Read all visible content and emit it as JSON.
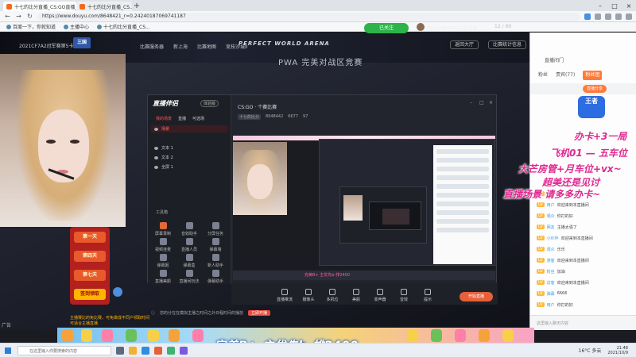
{
  "browser": {
    "tabs": [
      {
        "label": "十七的比分直播_CS:GO直播_斗..."
      },
      {
        "label": "十七的比分直播_CS..."
      }
    ],
    "url": "https://www.douyu.com/8648421_r=0.24240187069741187",
    "bookmarks": [
      "百度一下，你就知道",
      "主播中心",
      "十七的比分直播_CS..."
    ]
  },
  "stream": {
    "arena_title": "PERFECT WORLD ARENA",
    "arena_sub": "2021CF7A2冠军赛第5卡",
    "arena_logo": "三国",
    "follow_label": "已关注",
    "host_name": "douyu8648442比分直…",
    "viewer_count": "12 / 69",
    "game_links": [
      "比赛服务器",
      "新上海",
      "比赛地图",
      "竞技沙城II"
    ],
    "game_btn1": "返回大厅",
    "game_btn2": "比赛统计信息",
    "pwa_text": "PWA 完美对战区竞赛"
  },
  "promo": {
    "lines": [
      "第一天",
      "第四天",
      "第七天",
      "签到领取"
    ],
    "note": "主播赛比的免比赛，可免做成不同户领取时间可适合主播直播",
    "side_tab": "广告"
  },
  "obs": {
    "brand": "直播伴侣",
    "badge": "体验版",
    "tabs": [
      "我的场景",
      "直播",
      "可选场"
    ],
    "scenes": [
      "场景",
      "文本 1",
      "文本 2",
      "全屏 1"
    ],
    "tools_label": "工具箱",
    "tools": [
      "屏幕录制",
      "音效助手",
      "分屏任务",
      "视频连麦",
      "直播人员",
      "弹幕墙",
      "弹幕姬",
      "弹幕盒",
      "新人助手",
      "直播美颜",
      "直播间玩法",
      "弹幕助手"
    ],
    "game_name": "CS:GO · 个赛比赛",
    "stats": [
      "十七的比分",
      "8648442",
      "6677",
      "97"
    ],
    "inner_strip_text": "完美B+ 主优先b-排2400",
    "bottom_buttons": [
      "直播推流",
      "摄像头",
      "多机位",
      "美颜",
      "变声器",
      "音效",
      "提示"
    ],
    "start_label": "开始直播",
    "tip_text": "您的分在在模拟主播之时间之外日程时间的播放",
    "tip_action": "立即开播"
  },
  "chat": {
    "top_text": "直播间门",
    "tabs": [
      "粉丝",
      "贵宾(77)",
      "粉丝团"
    ],
    "strip_btn": "直播分享",
    "logo": "王者",
    "messages": [
      {
        "name": "欢迎",
        "text": "加入主播"
      },
      {
        "name": "用户",
        "text": "欢迎来到本直播间"
      },
      {
        "name": "观众",
        "text": "你打的好"
      },
      {
        "name": "网友",
        "text": "主播太强了"
      },
      {
        "name": "小伙伴",
        "text": "欢迎来到本直播间"
      },
      {
        "name": "观众",
        "text": "乐乐"
      },
      {
        "name": "游客",
        "text": "欢迎来到本直播间"
      },
      {
        "name": "粉丝",
        "text": "加油"
      },
      {
        "name": "访客",
        "text": "欢迎来到本直播间"
      },
      {
        "name": "弹幕",
        "text": "6666"
      },
      {
        "name": "用户",
        "text": "你打的好"
      }
    ],
    "input_placeholder": "这里输入聊天内容"
  },
  "handwriting": [
    "办卡+3一局",
    "飞机01 — 五车位",
    "大芒房管+月车位+vx~",
    "超美还是见讨",
    "直播场景 请多多办卡~"
  ],
  "marquee_text": "完美B+ 主优先b-排2400",
  "taskbar": {
    "search_placeholder": "在这里输入你要搜索的内容",
    "weather": "16°C 多云",
    "time": "21:48",
    "date": "2021/10/9"
  },
  "colors": {
    "accent_orange": "#e8603a",
    "follow_green": "#2cb34a",
    "handwriting_pink": "#e0288f"
  }
}
